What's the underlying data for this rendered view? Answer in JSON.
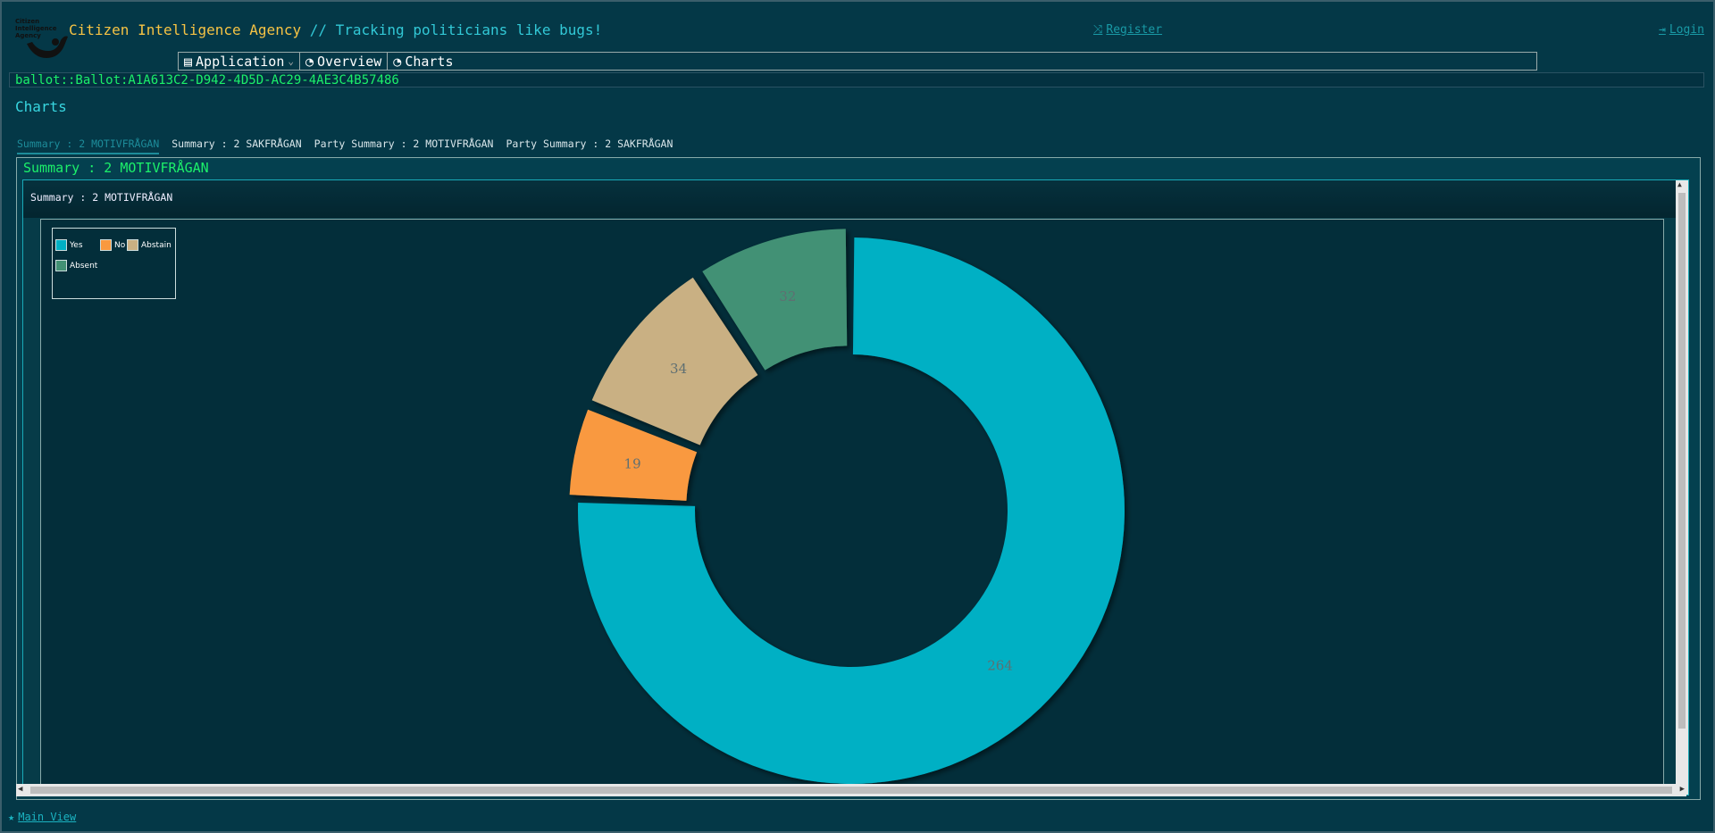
{
  "header": {
    "logo_text": "Citizen Intelligence Agency",
    "title_main": "Citizen Intelligence Agency",
    "title_sep": " // ",
    "title_tagline": "Tracking politicians like bugs!",
    "register": "Register",
    "login": "Login"
  },
  "menu": {
    "application": "Application",
    "overview": "Overview",
    "charts": "Charts"
  },
  "ballot_id": "ballot::Ballot:A1A613C2-D942-4D5D-AC29-4AE3C4B57486",
  "section_title": "Charts",
  "tabs": [
    "Summary : 2 MOTIVFRÅGAN",
    "Summary : 2 SAKFRÅGAN",
    "Party Summary : 2 MOTIVFRÅGAN",
    "Party Summary : 2 SAKFRÅGAN"
  ],
  "panel_title": "Summary : 2 MOTIVFRÅGAN",
  "chart_data": {
    "type": "pie",
    "title": "Summary : 2 MOTIVFRÅGAN",
    "donut": true,
    "legend_position": "top-left",
    "slices": [
      {
        "label": "Yes",
        "value": 264,
        "color": "#00b0c4"
      },
      {
        "label": "No",
        "value": 19,
        "color": "#f9993f"
      },
      {
        "label": "Abstain",
        "value": 34,
        "color": "#c9b083"
      },
      {
        "label": "Absent",
        "value": 32,
        "color": "#429174"
      }
    ]
  },
  "footer": {
    "main_view": "Main View"
  }
}
